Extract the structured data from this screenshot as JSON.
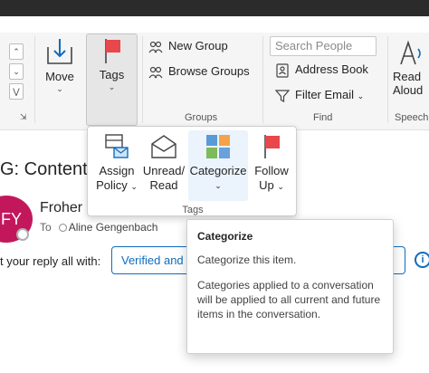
{
  "colors": {
    "accent": "#0f6cbd",
    "flag": "#e8474b",
    "avatar": "#c2185b"
  },
  "ribbon": {
    "mini_controls": [
      "⌃",
      "⌄",
      "⋁"
    ],
    "move": {
      "label": "Move",
      "icon": "move-icon"
    },
    "tags": {
      "label": "Tags",
      "icon": "flag-icon"
    },
    "new_group": "New Group",
    "browse_groups": "Browse Groups",
    "groups_label": "Groups",
    "search_placeholder": "Search People",
    "address_book": "Address Book",
    "filter_email": "Filter Email",
    "find_label": "Find",
    "read_aloud": {
      "line1": "Read",
      "line2": "Aloud"
    },
    "speech_label": "Speech"
  },
  "dropdown": {
    "items": [
      {
        "line1": "Assign",
        "line2": "Policy",
        "icon": "assign-policy-icon",
        "has_chevron": true
      },
      {
        "line1": "Unread/",
        "line2": "Read",
        "icon": "envelope-icon",
        "has_chevron": false
      },
      {
        "line1": "Categorize",
        "line2": "",
        "icon": "categorize-icon",
        "has_chevron": true
      },
      {
        "line1": "Follow",
        "line2": "Up",
        "icon": "flag-icon",
        "has_chevron": true
      }
    ],
    "footer": "Tags"
  },
  "email": {
    "subject": "G: Content",
    "avatar_initials": "FY",
    "sender": "Froher",
    "to_label": "To",
    "recipient": "Aline Gengenbach",
    "reply_prompt": "t your reply all with:",
    "reply_suggestion": "Verified and r",
    "reply_suggestion_right": "!"
  },
  "tooltip": {
    "title": "Categorize",
    "short": "Categorize this item.",
    "detail": "Categories applied to a conversation will be applied to all current and future items in the conversation."
  }
}
